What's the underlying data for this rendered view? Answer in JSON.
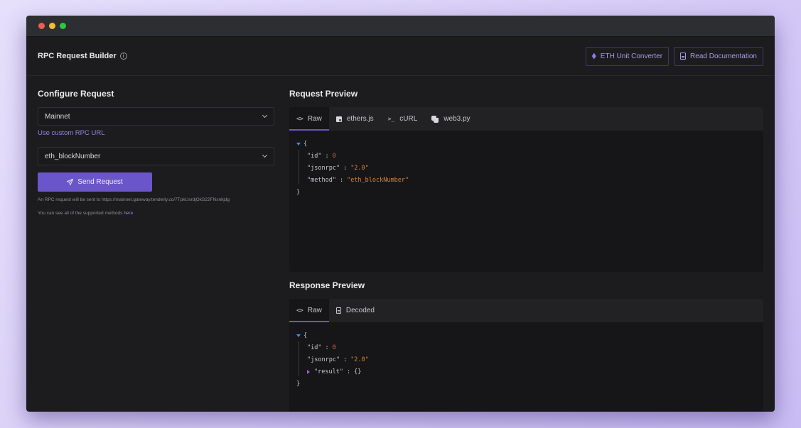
{
  "window": {
    "controls": [
      "close",
      "minimize",
      "maximize"
    ]
  },
  "header": {
    "title": "RPC Request Builder",
    "info_icon": "info-circle-icon",
    "actions": [
      {
        "label": "ETH Unit Converter",
        "icon": "ethereum-icon"
      },
      {
        "label": "Read Documentation",
        "icon": "document-icon"
      }
    ]
  },
  "configure": {
    "title": "Configure Request",
    "network_select": {
      "value": "Mainnet"
    },
    "custom_rpc_link": "Use custom RPC URL",
    "method_select": {
      "value": "eth_blockNumber"
    },
    "send_button": "Send Request",
    "note_sent_to": "An RPC request will be sent to https://mainnet.gateway.tenderly.co/7TpkUsrdjOkS22FNsnkjdg",
    "note_methods_prefix": "You can see all of the supported methods",
    "note_methods_link": "here"
  },
  "request_preview": {
    "title": "Request Preview",
    "tabs": [
      {
        "label": "Raw",
        "icon": "code-icon",
        "active": true
      },
      {
        "label": "ethers.js",
        "icon": "js-icon",
        "active": false
      },
      {
        "label": "cURL",
        "icon": "terminal-icon",
        "active": false
      },
      {
        "label": "web3.py",
        "icon": "python-icon",
        "active": false
      }
    ],
    "json": {
      "open_brace": "{",
      "close_brace": "}",
      "entries": [
        {
          "key": "\"id\"",
          "value": "0",
          "type": "number"
        },
        {
          "key": "\"jsonrpc\"",
          "value": "\"2.0\"",
          "type": "string"
        },
        {
          "key": "\"method\"",
          "value": "\"eth_blockNumber\"",
          "type": "string"
        }
      ]
    }
  },
  "response_preview": {
    "title": "Response Preview",
    "tabs": [
      {
        "label": "Raw",
        "icon": "code-icon",
        "active": true
      },
      {
        "label": "Decoded",
        "icon": "document-icon",
        "active": false
      }
    ],
    "json": {
      "open_brace": "{",
      "close_brace": "}",
      "entries": [
        {
          "key": "\"id\"",
          "value": "0",
          "type": "number"
        },
        {
          "key": "\"jsonrpc\"",
          "value": "\"2.0\"",
          "type": "string"
        },
        {
          "key": "\"result\"",
          "value": "{}",
          "type": "object",
          "collapsed": true
        }
      ]
    }
  },
  "colors": {
    "accent": "#6b56c9",
    "link": "#9584e6",
    "json_number": "#c8623f",
    "json_string": "#d6853b",
    "toggle_expanded": "#3b8ee8",
    "toggle_collapsed": "#a356d8"
  }
}
